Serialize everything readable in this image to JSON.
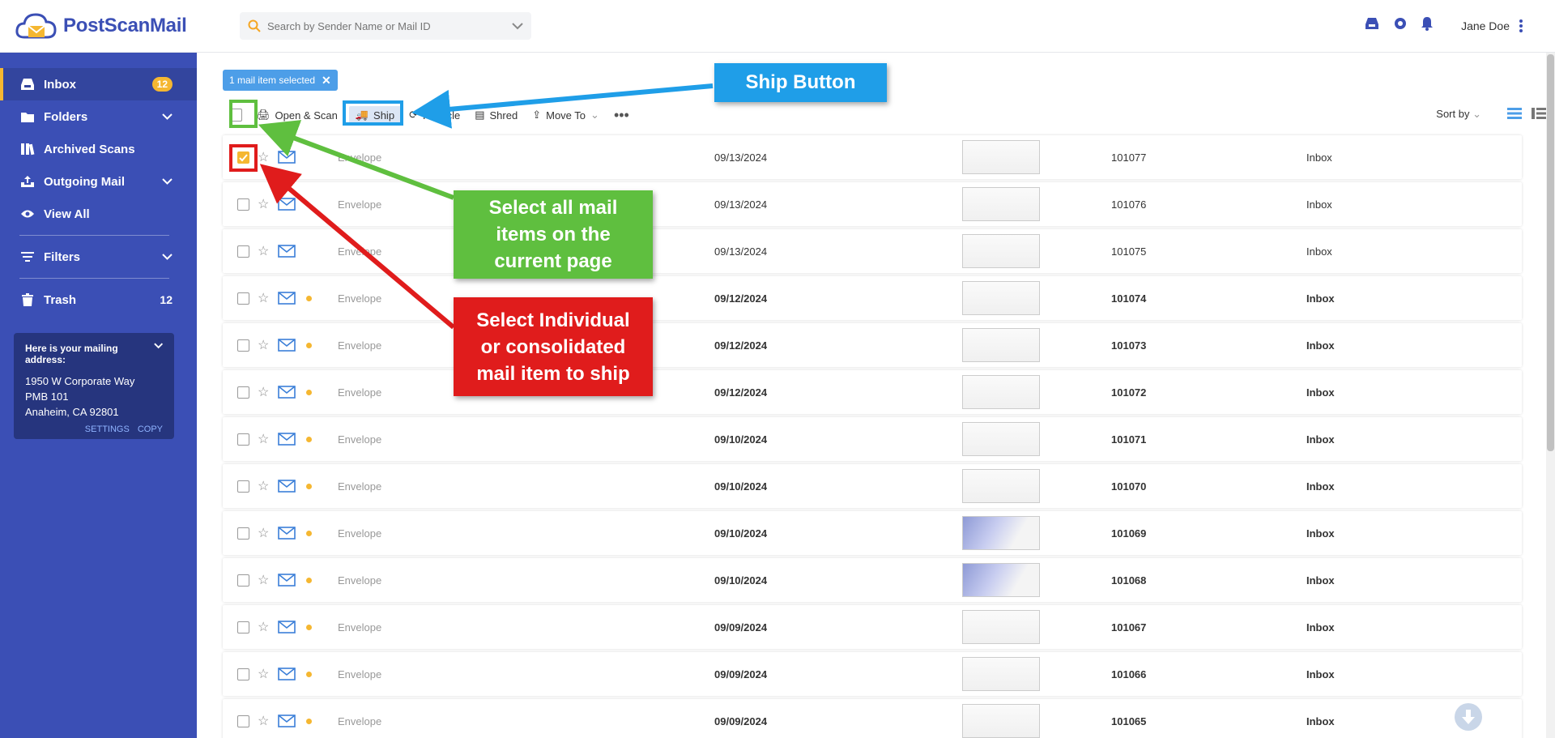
{
  "app": {
    "logo_text": "PostScanMail"
  },
  "header": {
    "search_placeholder": "Search by Sender Name or Mail ID",
    "user_name": "Jane Doe",
    "icons": [
      "inbox-tray-icon",
      "gear-icon",
      "bell-icon",
      "kebab-menu-icon"
    ]
  },
  "sidebar": {
    "items": [
      {
        "label": "Inbox",
        "badge": "12",
        "icon": "inbox-icon"
      },
      {
        "label": "Folders",
        "icon": "folder-icon"
      },
      {
        "label": "Archived Scans",
        "icon": "books-icon"
      },
      {
        "label": "Outgoing Mail",
        "icon": "outbox-icon"
      },
      {
        "label": "View All",
        "icon": "eye-icon"
      },
      {
        "label": "Filters",
        "icon": "filter-icon"
      },
      {
        "label": "Trash",
        "count": "12",
        "icon": "trash-icon"
      }
    ],
    "address": {
      "title": "Here is your mailing address:",
      "line1": "1950 W Corporate Way",
      "line2": "PMB 101",
      "line3": "Anaheim, CA 92801",
      "settings": "SETTINGS",
      "copy": "COPY"
    }
  },
  "toolbar": {
    "selected_chip": "1 mail item selected",
    "open_scan": "Open & Scan",
    "ship": "Ship",
    "recycle": "Recycle",
    "shred": "Shred",
    "move_to": "Move To",
    "sort_by": "Sort by"
  },
  "rows": [
    {
      "type": "Envelope",
      "date": "09/13/2024",
      "id": "101077",
      "folder": "Inbox",
      "checked": true,
      "unread": false
    },
    {
      "type": "Envelope",
      "date": "09/13/2024",
      "id": "101076",
      "folder": "Inbox",
      "checked": false,
      "unread": false
    },
    {
      "type": "Envelope",
      "date": "09/13/2024",
      "id": "101075",
      "folder": "Inbox",
      "checked": false,
      "unread": false
    },
    {
      "type": "Envelope",
      "date": "09/12/2024",
      "id": "101074",
      "folder": "Inbox",
      "checked": false,
      "unread": true
    },
    {
      "type": "Envelope",
      "date": "09/12/2024",
      "id": "101073",
      "folder": "Inbox",
      "checked": false,
      "unread": true
    },
    {
      "type": "Envelope",
      "date": "09/12/2024",
      "id": "101072",
      "folder": "Inbox",
      "checked": false,
      "unread": true
    },
    {
      "type": "Envelope",
      "date": "09/10/2024",
      "id": "101071",
      "folder": "Inbox",
      "checked": false,
      "unread": true
    },
    {
      "type": "Envelope",
      "date": "09/10/2024",
      "id": "101070",
      "folder": "Inbox",
      "checked": false,
      "unread": true
    },
    {
      "type": "Envelope",
      "date": "09/10/2024",
      "id": "101069",
      "folder": "Inbox",
      "checked": false,
      "unread": true
    },
    {
      "type": "Envelope",
      "date": "09/10/2024",
      "id": "101068",
      "folder": "Inbox",
      "checked": false,
      "unread": true
    },
    {
      "type": "Envelope",
      "date": "09/09/2024",
      "id": "101067",
      "folder": "Inbox",
      "checked": false,
      "unread": true
    },
    {
      "type": "Envelope",
      "date": "09/09/2024",
      "id": "101066",
      "folder": "Inbox",
      "checked": false,
      "unread": true
    },
    {
      "type": "Envelope",
      "date": "09/09/2024",
      "id": "101065",
      "folder": "Inbox",
      "checked": false,
      "unread": true
    }
  ],
  "annotations": {
    "ship_button": "Ship Button",
    "select_all_1": "Select all mail",
    "select_all_2": "items on the",
    "select_all_3": "current page",
    "select_individual_1": "Select Individual",
    "select_individual_2": "or consolidated",
    "select_individual_3": "mail item to ship"
  },
  "colors": {
    "sidebar": "#3b4fb5",
    "accent": "#f5b731",
    "annot_blue": "#1f9ee8",
    "annot_green": "#5fbf3f",
    "annot_red": "#e01c1c"
  }
}
